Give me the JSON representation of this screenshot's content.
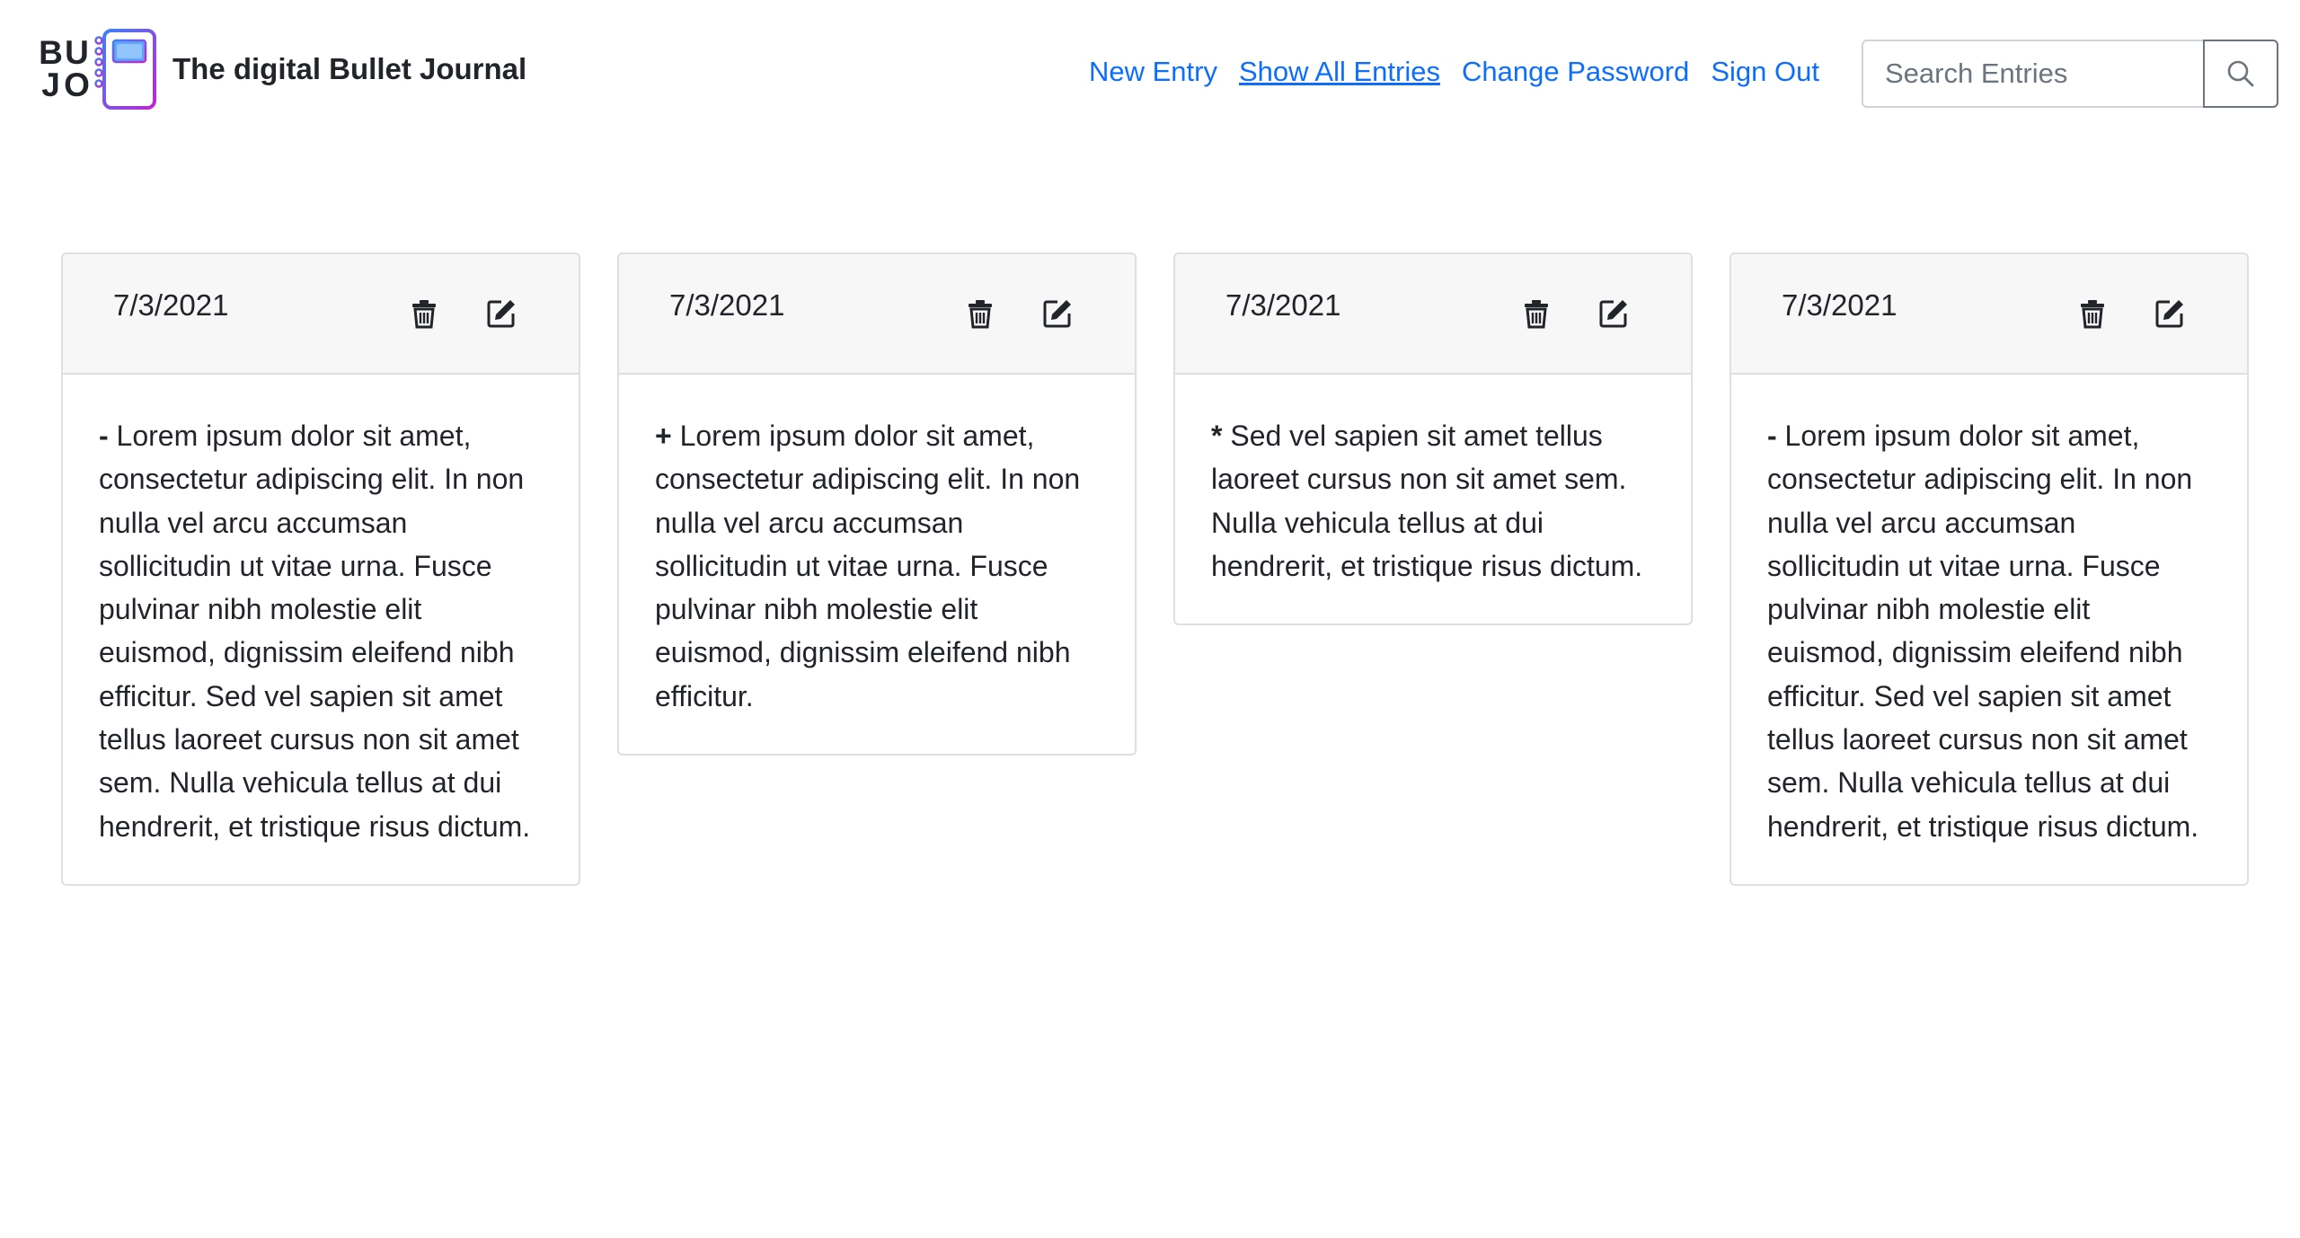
{
  "brand": {
    "logo_letters": [
      "B",
      "U",
      "J",
      "O"
    ],
    "title": "The digital Bullet Journal"
  },
  "nav": {
    "links": [
      {
        "label": "New Entry",
        "active": false
      },
      {
        "label": "Show All Entries",
        "active": true
      },
      {
        "label": "Change Password",
        "active": false
      },
      {
        "label": "Sign Out",
        "active": false
      }
    ]
  },
  "search": {
    "placeholder": "Search Entries",
    "value": "",
    "button_icon": "search-icon"
  },
  "icons": {
    "delete": "trash-icon",
    "edit": "edit-icon"
  },
  "colors": {
    "link": "#0d6efd",
    "logo_gradient_start": "#3b82f6",
    "logo_gradient_end": "#c026d3",
    "card_header_bg": "#f7f7f7"
  },
  "entries": [
    {
      "date": "7/3/2021",
      "bullet": "-",
      "text": "Lorem ipsum dolor sit amet, consectetur adipiscing elit. In non nulla vel arcu accumsan sollicitudin ut vitae urna. Fusce pulvinar nibh molestie elit euismod, dignissim eleifend nibh efficitur. Sed vel sapien sit amet tellus laoreet cursus non sit amet sem. Nulla vehicula tellus at dui hendrerit, et tristique risus dictum."
    },
    {
      "date": "7/3/2021",
      "bullet": "+",
      "text": "Lorem ipsum dolor sit amet, consectetur adipiscing elit. In non nulla vel arcu accumsan sollicitudin ut vitae urna. Fusce pulvinar nibh molestie elit euismod, dignissim eleifend nibh efficitur."
    },
    {
      "date": "7/3/2021",
      "bullet": "*",
      "text": "Sed vel sapien sit amet tellus laoreet cursus non sit amet sem. Nulla vehicula tellus at dui hendrerit, et tristique risus dictum."
    },
    {
      "date": "7/3/2021",
      "bullet": "-",
      "text": "Lorem ipsum dolor sit amet, consectetur adipiscing elit. In non nulla vel arcu accumsan sollicitudin ut vitae urna. Fusce pulvinar nibh molestie elit euismod, dignissim eleifend nibh efficitur. Sed vel sapien sit amet tellus laoreet cursus non sit amet sem. Nulla vehicula tellus at dui hendrerit, et tristique risus dictum."
    }
  ]
}
